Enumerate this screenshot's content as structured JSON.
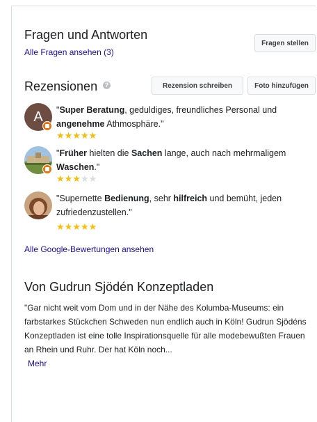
{
  "qa": {
    "title": "Fragen und Antworten",
    "all_questions_link": "Alle Fragen ansehen (3)",
    "ask_button": "Fragen stellen"
  },
  "reviews": {
    "title": "Rezensionen",
    "write_button": "Rezension schreiben",
    "add_photo_button": "Foto hinzufügen",
    "items": [
      {
        "avatar_letter": "A",
        "parts": [
          {
            "t": "\"",
            "b": false
          },
          {
            "t": "Super Beratung",
            "b": true
          },
          {
            "t": ", geduldiges, freundliches Personal und ",
            "b": false
          },
          {
            "t": "angenehme",
            "b": true
          },
          {
            "t": " Athmosphäre.\"",
            "b": false
          }
        ],
        "rating": 5
      },
      {
        "avatar_letter": "",
        "parts": [
          {
            "t": "\"",
            "b": false
          },
          {
            "t": "Früher",
            "b": true
          },
          {
            "t": " hielten die ",
            "b": false
          },
          {
            "t": "Sachen",
            "b": true
          },
          {
            "t": " lange, auch nach mehrmaligem ",
            "b": false
          },
          {
            "t": "Waschen",
            "b": true
          },
          {
            "t": ".\"",
            "b": false
          }
        ],
        "rating": 3
      },
      {
        "avatar_letter": "",
        "parts": [
          {
            "t": "\"Supernette ",
            "b": false
          },
          {
            "t": "Bedienung",
            "b": true
          },
          {
            "t": ", sehr ",
            "b": false
          },
          {
            "t": "hilfreich",
            "b": true
          },
          {
            "t": " und bemüht, jeden zufriedenzustellen.\"",
            "b": false
          }
        ],
        "rating": 5
      }
    ],
    "all_reviews_link": "Alle Google-Bewertungen ansehen"
  },
  "from_owner": {
    "title": "Von Gudrun Sjödén Konzeptladen",
    "description": "\"Gar nicht weit vom Dom und in der Nähe des Kolumba-Museums: ein farbstarkes Stückchen Schweden nun endlich auch in Köln! Gudrun Sjödéns Konzeptladen ist eine tolle Inspirationsquelle für alle modebewußten Frauen an Rhein und Ruhr. Der hat Köln noch...",
    "more_link": "Mehr"
  },
  "colors": {
    "link": "#1a0dab",
    "star": "#fbbc04",
    "star_empty": "#dadce0",
    "badge": "#e8710a"
  },
  "icons": {
    "help": "help-circle-icon",
    "star": "star-icon",
    "local-guide": "local-guide-badge-icon"
  }
}
